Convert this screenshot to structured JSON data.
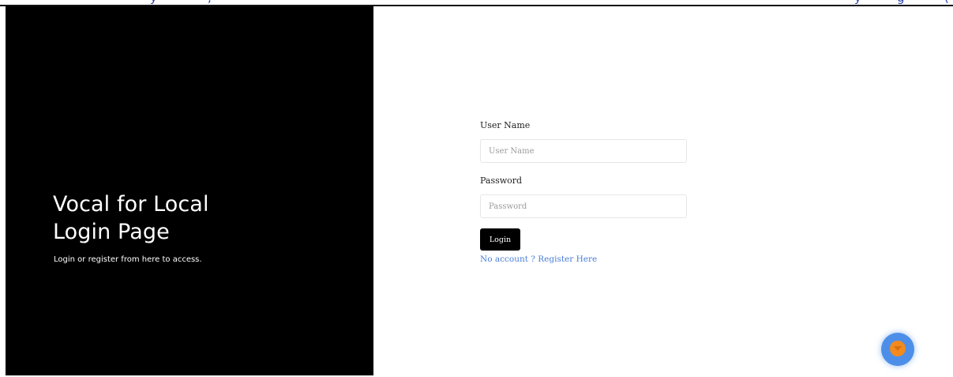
{
  "colors": {
    "panel_bg": "#000000",
    "link": "#4a7fd6",
    "button_bg": "#000000",
    "fab_outer": "#4d8fe8",
    "fab_inner": "#f28a1e"
  },
  "hero": {
    "title_line1": "Vocal for Local",
    "title_line2": "Login Page",
    "subtitle": "Login or register from here to access."
  },
  "login_form": {
    "username_label": "User Name",
    "username_placeholder": "User Name",
    "username_value": "",
    "password_label": "Password",
    "password_placeholder": "Password",
    "password_value": "",
    "login_button": "Login",
    "register_link": "No account ? Register Here"
  },
  "fab": {
    "icon": "chevron-down-icon"
  }
}
